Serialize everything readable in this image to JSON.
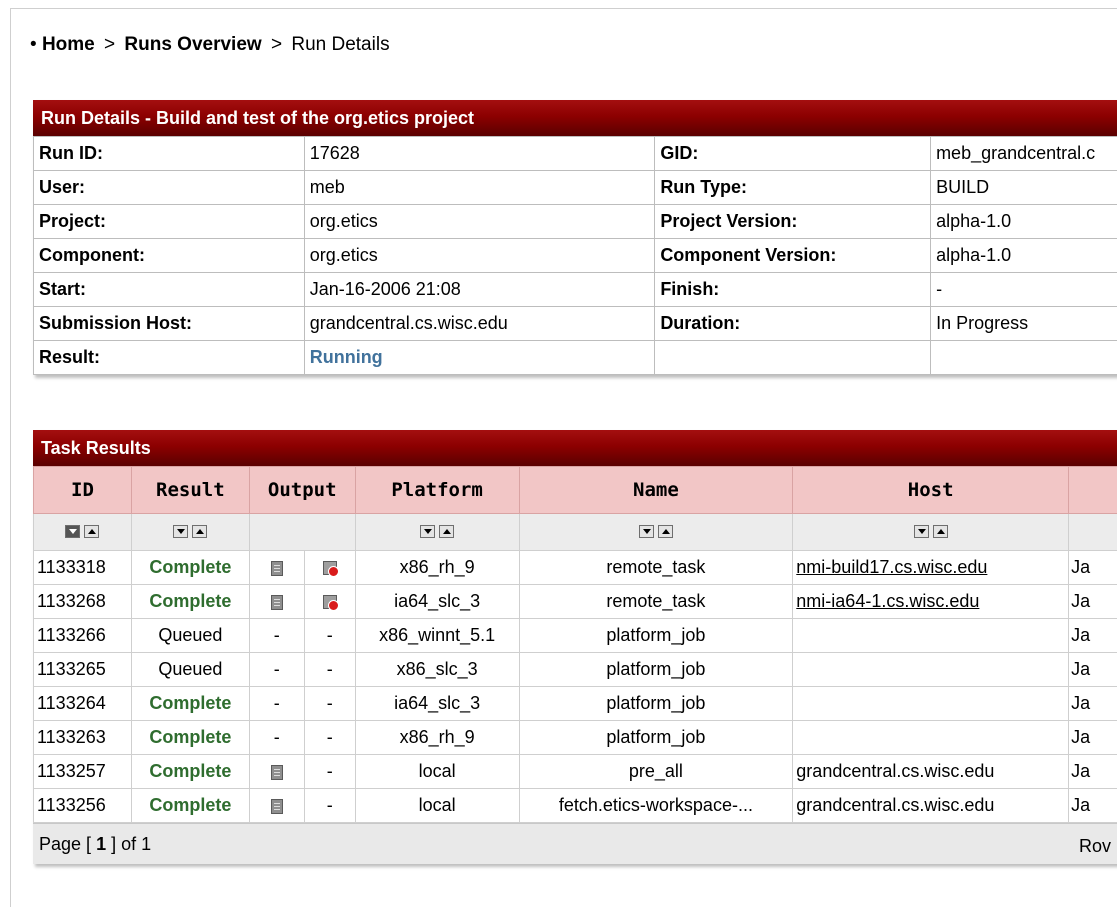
{
  "breadcrumb": {
    "bullet": "•",
    "home": "Home",
    "sep1": ">",
    "runs_overview": "Runs Overview",
    "sep2": ">",
    "current": "Run Details"
  },
  "run_details": {
    "title": "Run Details - Build and test of the org.etics project",
    "run_id_label": "Run ID:",
    "run_id": "17628",
    "gid_label": "GID:",
    "gid": "meb_grandcentral.c",
    "user_label": "User:",
    "user": "meb",
    "run_type_label": "Run Type:",
    "run_type": "BUILD",
    "project_label": "Project:",
    "project": "org.etics",
    "project_version_label": "Project Version:",
    "project_version": "alpha-1.0",
    "component_label": "Component:",
    "component": "org.etics",
    "component_version_label": "Component Version:",
    "component_version": "alpha-1.0",
    "start_label": "Start:",
    "start": "Jan-16-2006 21:08",
    "finish_label": "Finish:",
    "finish": "-",
    "submission_host_label": "Submission Host:",
    "submission_host": "grandcentral.cs.wisc.edu",
    "duration_label": "Duration:",
    "duration": "In Progress",
    "result_label": "Result:",
    "result": "Running"
  },
  "task_results": {
    "title": "Task Results",
    "columns": {
      "id": "ID",
      "result": "Result",
      "output": "Output",
      "platform": "Platform",
      "name": "Name",
      "host": "Host"
    },
    "rows": [
      {
        "id": "1133318",
        "result": "Complete",
        "out1": "",
        "out2": "",
        "platform": "x86_rh_9",
        "name": "remote_task",
        "host": "nmi-build17.cs.wisc.edu",
        "date": "Ja"
      },
      {
        "id": "1133268",
        "result": "Complete",
        "out1": "",
        "out2": "",
        "platform": "ia64_slc_3",
        "name": "remote_task",
        "host": "nmi-ia64-1.cs.wisc.edu",
        "date": "Ja"
      },
      {
        "id": "1133266",
        "result": "Queued",
        "out1": "-",
        "out2": "-",
        "platform": "x86_winnt_5.1",
        "name": "platform_job",
        "host": "",
        "date": "Ja"
      },
      {
        "id": "1133265",
        "result": "Queued",
        "out1": "-",
        "out2": "-",
        "platform": "x86_slc_3",
        "name": "platform_job",
        "host": "",
        "date": "Ja"
      },
      {
        "id": "1133264",
        "result": "Complete",
        "out1": "-",
        "out2": "-",
        "platform": "ia64_slc_3",
        "name": "platform_job",
        "host": "",
        "date": "Ja"
      },
      {
        "id": "1133263",
        "result": "Complete",
        "out1": "-",
        "out2": "-",
        "platform": "x86_rh_9",
        "name": "platform_job",
        "host": "",
        "date": "Ja"
      },
      {
        "id": "1133257",
        "result": "Complete",
        "out1": "",
        "out2": "-",
        "platform": "local",
        "name": "pre_all",
        "host": "grandcentral.cs.wisc.edu",
        "date": "Ja"
      },
      {
        "id": "1133256",
        "result": "Complete",
        "out1": "",
        "out2": "-",
        "platform": "local",
        "name": "fetch.etics-workspace-...",
        "host": "grandcentral.cs.wisc.edu",
        "date": "Ja"
      }
    ],
    "pagination": {
      "prefix": "Page [",
      "current": "1",
      "suffix": "] of 1",
      "rows_label": "Rov"
    }
  },
  "colors": {
    "header_red": "#8c0000",
    "column_header_pink": "#f2c6c6",
    "complete_green": "#2f6d2f",
    "running_blue": "#41729c"
  }
}
